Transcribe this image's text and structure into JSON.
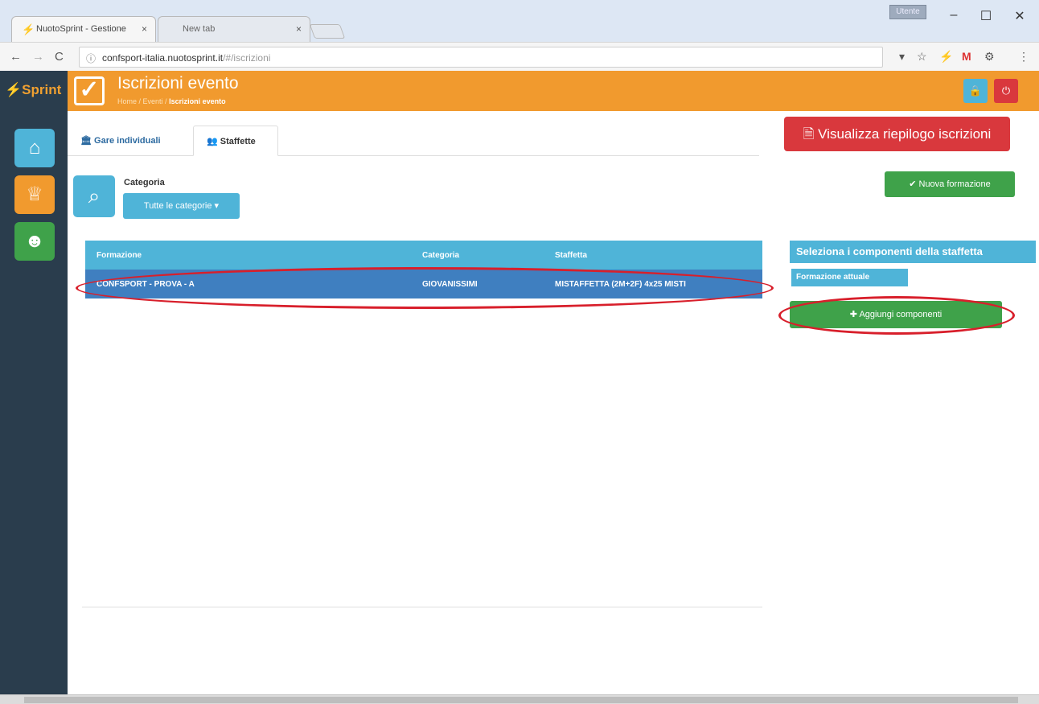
{
  "browser": {
    "tabs": [
      {
        "label": "NuotoSprint - Gestione"
      },
      {
        "label": "New tab"
      }
    ],
    "user_badge": "Utente",
    "url_host": "confsport-italia.nuotosprint.it",
    "url_path": "/#/iscrizioni"
  },
  "app": {
    "logo": "Sprint",
    "header_title": "Iscrizioni evento",
    "breadcrumb": {
      "home": "Home",
      "sep1": " / ",
      "events": "Eventi",
      "sep2": " / ",
      "current": "Iscrizioni evento"
    }
  },
  "page_tabs": [
    {
      "label": "Gare individuali",
      "icon": "bank-icon"
    },
    {
      "label": "Staffette",
      "icon": "users-icon"
    }
  ],
  "filter": {
    "label": "Categoria",
    "dropdown_value": "Tutte le categorie ▾"
  },
  "actions": {
    "summary_button": "Visualizza riepilogo iscrizioni",
    "new_formation_button": "Nuova formazione",
    "add_components_button": "Aggiungi componenti"
  },
  "table": {
    "headers": [
      "Formazione",
      "Categoria",
      "Staffetta"
    ],
    "rows": [
      [
        "CONFSPORT - PROVA - A",
        "GIOVANISSIMI",
        "MISTAFFETTA (2M+2F) 4x25 MISTI"
      ]
    ]
  },
  "right_panel": {
    "title": "Seleziona i componenti della staffetta",
    "subtitle": "Formazione attuale"
  },
  "colors": {
    "header": "#f19a2e",
    "sidebar": "#2a3d4d",
    "primary": "#4fb4d8",
    "danger": "#d9383d",
    "success": "#3fa24a",
    "highlight": "#d81f2b"
  }
}
